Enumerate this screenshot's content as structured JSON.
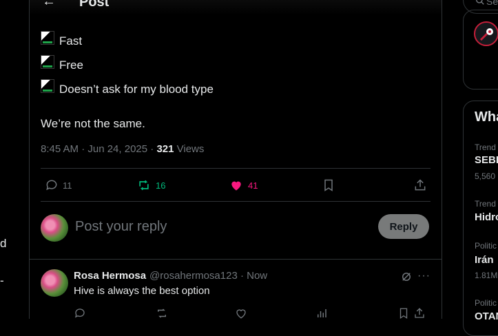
{
  "left_nav": {
    "fragment_1": "d",
    "fragment_2": "-"
  },
  "header": {
    "back_icon": "arrow-left-icon",
    "title": "Post"
  },
  "post": {
    "bullets": [
      {
        "text": "Fast"
      },
      {
        "text": "Free"
      },
      {
        "text": "Doesn’t ask for my blood type"
      }
    ],
    "body": "We’re not the same.",
    "timestamp": "8:45 AM · Jun 24, 2025 · ",
    "views_count": "321",
    "views_label": " Views",
    "actions": {
      "replies": "11",
      "reposts": "16",
      "likes": "41"
    },
    "colors": {
      "repost": "#00ba7c",
      "like": "#f91880",
      "muted": "#71767b"
    }
  },
  "reply_box": {
    "placeholder": "Post your reply",
    "button": "Reply"
  },
  "replies": [
    {
      "name": "Rosa Hermosa",
      "handle": "@rosahermosa123 · Now",
      "text": "Hive is always the best option"
    }
  ],
  "sidebar": {
    "search_fragment": "Se",
    "trends_title": "Wha",
    "trends": [
      {
        "label": "Trend",
        "name": "SEBI",
        "count": "5,560"
      },
      {
        "label": "Trend",
        "name": "Hidro",
        "count": ""
      },
      {
        "label": "Politic",
        "name": "Irán",
        "count": "1.81M"
      },
      {
        "label": "Politic",
        "name": "OTAN",
        "count": ""
      }
    ]
  }
}
